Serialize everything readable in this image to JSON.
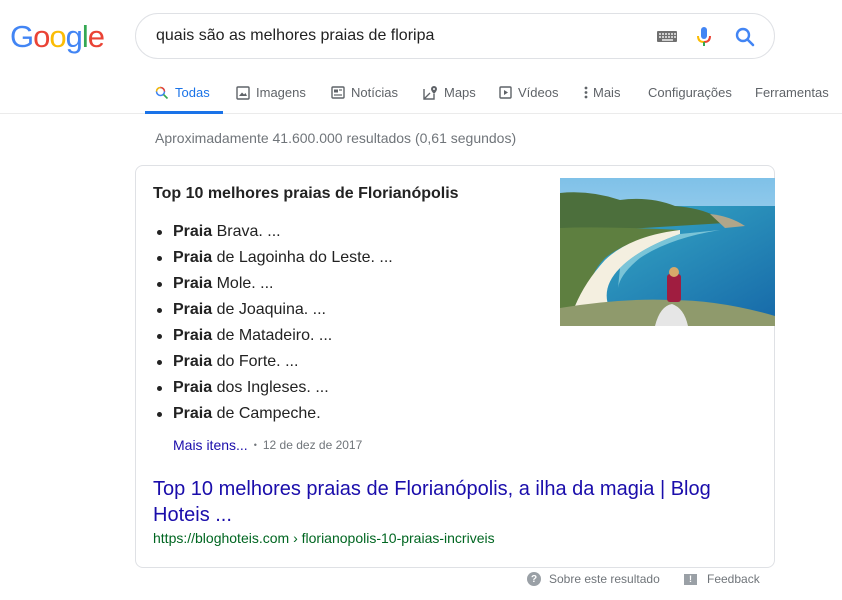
{
  "logo": {
    "letters": [
      "G",
      "o",
      "o",
      "g",
      "l",
      "e"
    ],
    "alt": "Google"
  },
  "search": {
    "query": "quais são as melhores praias de floripa",
    "icons": [
      "keyboard-icon",
      "microphone-icon",
      "search-icon"
    ]
  },
  "tabs": [
    {
      "label": "Todas",
      "icon": "search-icon",
      "active": true
    },
    {
      "label": "Imagens",
      "icon": "image-icon"
    },
    {
      "label": "Notícias",
      "icon": "news-icon"
    },
    {
      "label": "Maps",
      "icon": "map-pin-icon"
    },
    {
      "label": "Vídeos",
      "icon": "play-icon"
    },
    {
      "label": "Mais",
      "icon": "more-vert-icon"
    },
    {
      "label": "Configurações"
    },
    {
      "label": "Ferramentas"
    }
  ],
  "stats": "Aproximadamente 41.600.000 resultados (0,61 segundos)",
  "featured": {
    "title": "Top 10 melhores praias de Florianópolis",
    "items": [
      {
        "bold": "Praia",
        "rest": " Brava. ..."
      },
      {
        "bold": "Praia",
        "rest": " de Lagoinha do Leste. ..."
      },
      {
        "bold": "Praia",
        "rest": " Mole. ..."
      },
      {
        "bold": "Praia",
        "rest": " de Joaquina. ..."
      },
      {
        "bold": "Praia",
        "rest": " de Matadeiro. ..."
      },
      {
        "bold": "Praia",
        "rest": " do Forte. ..."
      },
      {
        "bold": "Praia",
        "rest": " dos Ingleses. ..."
      },
      {
        "bold": "Praia",
        "rest": " de Campeche."
      }
    ],
    "more_label": "Mais itens...",
    "separator": "•",
    "date": "12 de dez de 2017",
    "image_alt": "Vista da praia de Lagoinha do Leste com mulher sentada na rocha",
    "result_title": "Top 10 melhores praias de Florianópolis, a ilha da magia | Blog Hoteis ...",
    "result_url": "https://bloghoteis.com › florianopolis-10-praias-incriveis"
  },
  "footer": {
    "about_label": "Sobre este resultado",
    "feedback_label": "Feedback"
  },
  "colors": {
    "link": "#1a0dab",
    "url_green": "#006621",
    "accent_blue": "#1a73e8",
    "google_blue": "#4285f4",
    "google_red": "#ea4335",
    "google_yellow": "#fbbc05",
    "google_green": "#34a853"
  }
}
